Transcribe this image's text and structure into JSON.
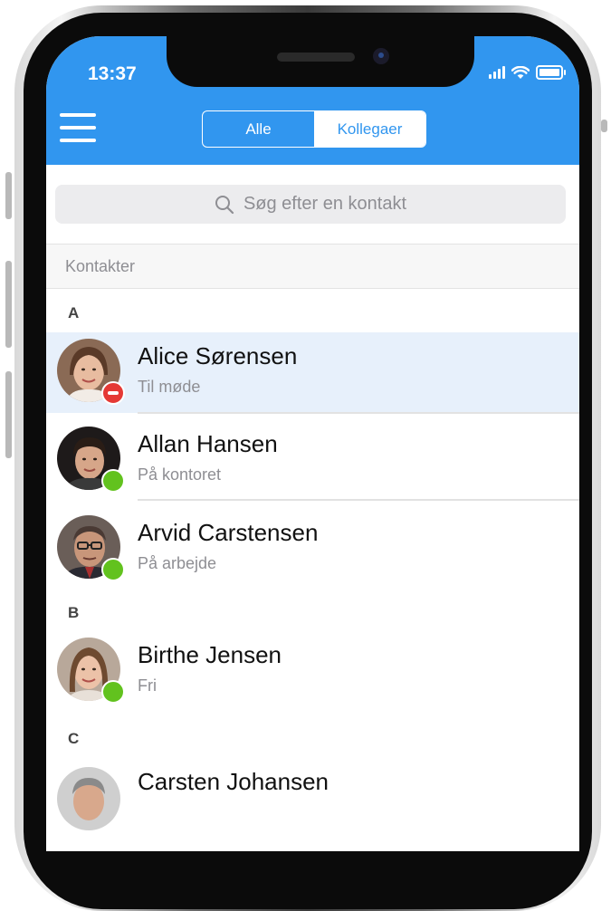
{
  "status_bar": {
    "time": "13:37",
    "signal_icon": "signal-icon",
    "wifi_icon": "wifi-icon",
    "battery_icon": "battery-icon"
  },
  "header": {
    "menu_icon": "hamburger-menu-icon",
    "segments": [
      {
        "label": "Alle",
        "selected": false
      },
      {
        "label": "Kollegaer",
        "selected": true
      }
    ]
  },
  "search": {
    "placeholder": "Søg efter en kontakt",
    "icon": "search-icon"
  },
  "section_title": "Kontakter",
  "groups": [
    {
      "letter": "A",
      "contacts": [
        {
          "name": "Alice Sørensen",
          "status": "Til møde",
          "presence": "busy",
          "selected": true
        },
        {
          "name": "Allan Hansen",
          "status": "På kontoret",
          "presence": "available",
          "selected": false
        },
        {
          "name": "Arvid Carstensen",
          "status": "På arbejde",
          "presence": "available",
          "selected": false
        }
      ]
    },
    {
      "letter": "B",
      "contacts": [
        {
          "name": "Birthe Jensen",
          "status": "Fri",
          "presence": "available",
          "selected": false
        }
      ]
    },
    {
      "letter": "C",
      "contacts": [
        {
          "name": "Carsten Johansen",
          "status": "",
          "presence": "",
          "selected": false
        }
      ]
    }
  ],
  "colors": {
    "accent": "#3196ef",
    "selected_row": "#e7f0fb",
    "busy": "#e53935",
    "available": "#62c21e"
  }
}
